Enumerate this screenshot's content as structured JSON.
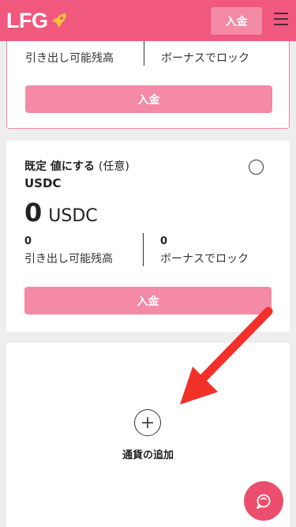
{
  "header": {
    "logo_text": "LFG",
    "deposit_label": "入金",
    "menu_icon": "hamburger-menu-icon",
    "brand_color": "#f0587e"
  },
  "wallet_card_1": {
    "withdrawable_label": "引き出し可能残高",
    "bonus_label": "ボーナスでロック",
    "deposit_label": "入金"
  },
  "wallet_card_2": {
    "title": "既定 値にする",
    "title_optional": "(任意)",
    "currency": "USDC",
    "balance_amount": "0",
    "balance_unit": "USDC",
    "withdrawable_amount": "0",
    "withdrawable_label": "引き出し可能残高",
    "bonus_amount": "0",
    "bonus_label": "ボーナスでロック",
    "deposit_label": "入金"
  },
  "add_currency": {
    "label": "通貨の追加",
    "icon": "plus-icon"
  },
  "overlay": {
    "arrow_color": "#f2302a",
    "chat_icon": "chat-support-icon"
  }
}
